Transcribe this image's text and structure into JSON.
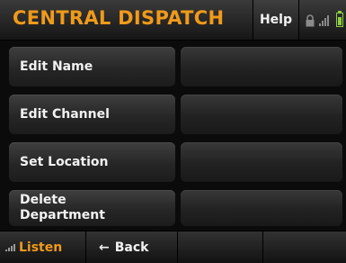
{
  "header": {
    "title": "CENTRAL DISPATCH",
    "help_label": "Help"
  },
  "menu": {
    "items": [
      {
        "label": "Edit Name",
        "value": ""
      },
      {
        "label": "Edit Channel",
        "value": ""
      },
      {
        "label": "Set Location",
        "value": ""
      },
      {
        "label": "Delete Department",
        "value": ""
      }
    ]
  },
  "footer": {
    "listen_label": "Listen",
    "back_label": "Back"
  },
  "icons": {
    "lock": "lock-icon",
    "signal": "signal-bars-icon",
    "battery": "battery-icon",
    "back": "arrow-left-icon"
  },
  "colors": {
    "accent": "#f09a1a",
    "battery": "#8fd13f"
  }
}
